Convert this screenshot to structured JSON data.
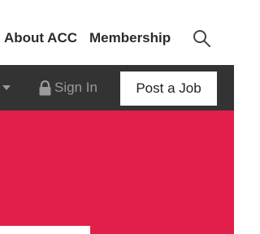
{
  "top_nav": {
    "about_label": "About ACC",
    "membership_label": "Membership",
    "search_icon": "search-icon"
  },
  "utility_bar": {
    "dropdown_icon": "caret-down-icon",
    "sign_in_label": "Sign In",
    "sign_in_icon": "lock-icon",
    "post_job_label": "Post a Job"
  },
  "colors": {
    "top_nav_bg": "#ffffff",
    "utility_bar_bg": "#333333",
    "hero_bg": "#e21f4a",
    "sign_in_text": "#9a9a9a",
    "post_job_bg": "#ffffff"
  }
}
